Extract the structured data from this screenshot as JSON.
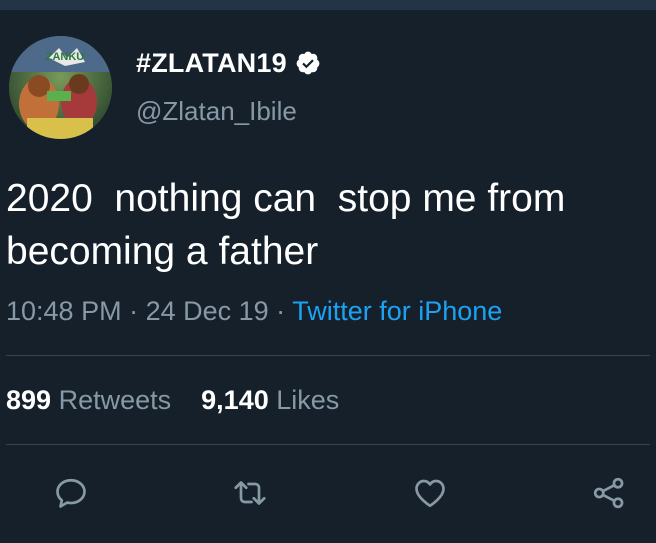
{
  "tweet": {
    "author": {
      "display_name": "#ZLATAN19",
      "handle": "@Zlatan_Ibile",
      "verified": true,
      "avatar_text": "ZANKU"
    },
    "text": "2020  nothing can  stop me from becoming a father",
    "time": "10:48 PM",
    "date": "24 Dec 19",
    "separator": " · ",
    "source": "Twitter for iPhone",
    "retweets_count": "899",
    "retweets_label": "Retweets",
    "likes_count": "9,140",
    "likes_label": "Likes"
  },
  "actions": [
    "reply-icon",
    "retweet-icon",
    "like-icon",
    "share-icon"
  ],
  "colors": {
    "background": "#15202b",
    "secondary_text": "#8899a6",
    "link": "#1da1f2",
    "divider": "#38444d",
    "verified": "#ffffff"
  }
}
